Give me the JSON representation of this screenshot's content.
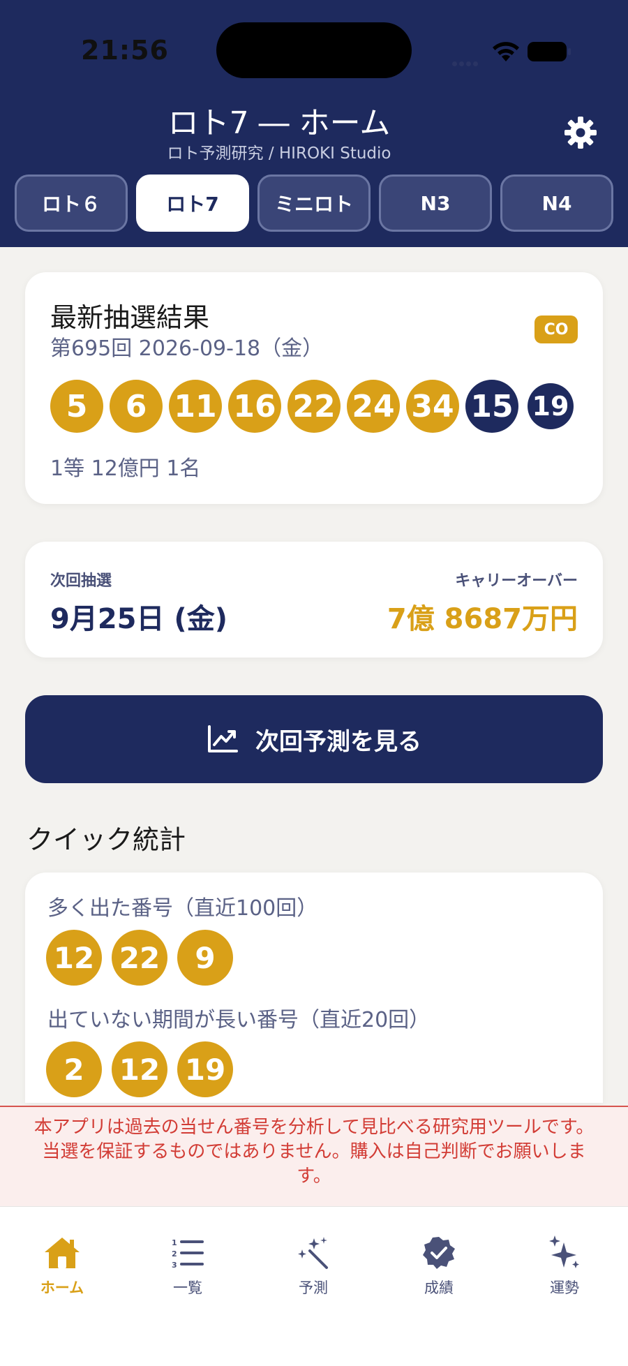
{
  "status_bar": {
    "time": "21:56"
  },
  "header": {
    "title": "ロト7 ― ホーム",
    "subtitle": "ロト予測研究 / HIROKI Studio",
    "tabs": [
      {
        "label": "ロト６",
        "active": false
      },
      {
        "label": "ロト7",
        "active": true
      },
      {
        "label": "ミニロト",
        "active": false
      },
      {
        "label": "N3",
        "active": false
      },
      {
        "label": "N4",
        "active": false
      }
    ]
  },
  "latest_result": {
    "title": "最新抽選結果",
    "meta": "第695回  2026-09-18（金）",
    "badge": "CO",
    "main_numbers": [
      "5",
      "6",
      "11",
      "16",
      "22",
      "24",
      "34"
    ],
    "bonus_numbers": [
      "15",
      "19"
    ],
    "prize": "1等 12億円  1名"
  },
  "next_draw": {
    "label": "次回抽選",
    "date": "9月25日 (金)",
    "carryover_label": "キャリーオーバー",
    "carryover_amount": "7億 8687万円"
  },
  "predict_button": {
    "label": "次回予測を見る",
    "icon": "chart-line-icon"
  },
  "quick_stats": {
    "heading": "クイック統計",
    "frequent_label": "多く出た番号（直近100回）",
    "frequent_numbers": [
      "12",
      "22",
      "9"
    ],
    "cold_label": "出ていない期間が長い番号（直近20回）",
    "cold_numbers": [
      "2",
      "12",
      "19"
    ]
  },
  "disclaimer": "本アプリは過去の当せん番号を分析して見比べる研究用ツールです。当選を保証するものではありません。購入は自己判断でお願いします。",
  "tabbar": [
    {
      "label": "ホーム",
      "icon": "home-icon",
      "active": true
    },
    {
      "label": "一覧",
      "icon": "numbered-list-icon",
      "active": false
    },
    {
      "label": "予測",
      "icon": "magic-wand-icon",
      "active": false
    },
    {
      "label": "成績",
      "icon": "verified-badge-icon",
      "active": false
    },
    {
      "label": "運勢",
      "icon": "sparkles-icon",
      "active": false
    }
  ],
  "colors": {
    "navy": "#1e2a5e",
    "gold": "#d9a018",
    "warning_red": "#d23c35"
  }
}
